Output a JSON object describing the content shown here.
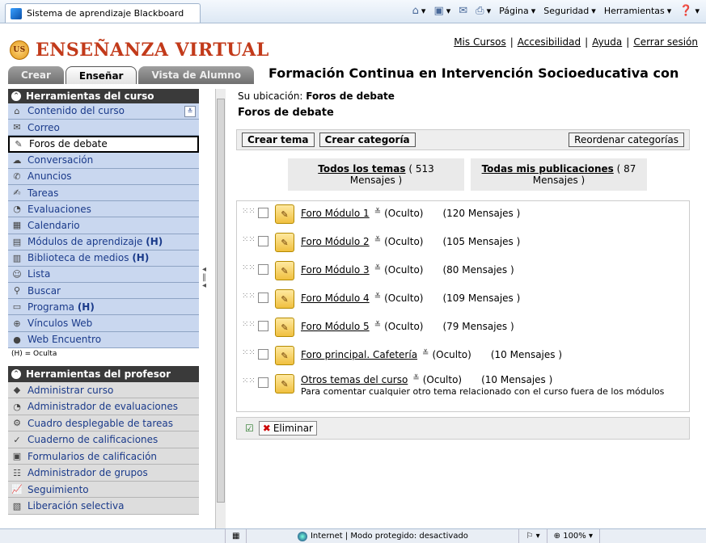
{
  "browser": {
    "tab_title": "Sistema de aprendizaje Blackboard",
    "commands": [
      "Página",
      "Seguridad",
      "Herramientas"
    ],
    "status": "Internet | Modo protegido: desactivado",
    "zoom": "100%"
  },
  "header": {
    "logo": "ENSEÑANZA VIRTUAL",
    "links": [
      "Mis Cursos",
      "Accesibilidad",
      "Ayuda",
      "Cerrar sesión"
    ],
    "tabs": [
      "Crear",
      "Enseñar",
      "Vista de Alumno"
    ],
    "course_title": "Formación Continua en Intervención Socioeducativa con"
  },
  "sidebar": {
    "course_tools_title": "Herramientas del curso",
    "items": [
      {
        "label": "Contenido del curso",
        "icon": "home-icon"
      },
      {
        "label": "Correo",
        "icon": "mail-icon"
      },
      {
        "label": "Foros de debate",
        "icon": "forum-icon"
      },
      {
        "label": "Conversación",
        "icon": "chat-icon"
      },
      {
        "label": "Anuncios",
        "icon": "megaphone-icon"
      },
      {
        "label": "Tareas",
        "icon": "assignment-icon"
      },
      {
        "label": "Evaluaciones",
        "icon": "assessment-icon"
      },
      {
        "label": "Calendario",
        "icon": "calendar-icon"
      },
      {
        "label": "Módulos de aprendizaje",
        "suffix": "(H)",
        "icon": "module-icon"
      },
      {
        "label": "Biblioteca de medios",
        "suffix": "(H)",
        "icon": "media-icon"
      },
      {
        "label": "Lista",
        "icon": "roster-icon"
      },
      {
        "label": "Buscar",
        "icon": "search-icon"
      },
      {
        "label": "Programa",
        "suffix": "(H)",
        "icon": "syllabus-icon"
      },
      {
        "label": "Vínculos Web",
        "icon": "weblink-icon"
      },
      {
        "label": "Web Encuentro",
        "icon": "meeting-icon"
      }
    ],
    "hidden_note": "(H) = Oculta",
    "instructor_tools_title": "Herramientas del profesor",
    "instructor_items": [
      {
        "label": "Administrar curso",
        "icon": "manage-icon"
      },
      {
        "label": "Administrador de evaluaciones",
        "icon": "assessment-manager-icon"
      },
      {
        "label": "Cuadro desplegable de tareas",
        "icon": "dropbox-icon"
      },
      {
        "label": "Cuaderno de calificaciones",
        "icon": "gradebook-icon"
      },
      {
        "label": "Formularios de calificación",
        "icon": "rubric-icon"
      },
      {
        "label": "Administrador de grupos",
        "icon": "groups-icon"
      },
      {
        "label": "Seguimiento",
        "icon": "tracking-icon"
      },
      {
        "label": "Liberación selectiva",
        "icon": "release-icon"
      }
    ]
  },
  "main": {
    "location_label": "Su ubicación:",
    "location_value": "Foros de debate",
    "page_title": "Foros de debate",
    "buttons": {
      "create_topic": "Crear tema",
      "create_category": "Crear categoría",
      "reorder": "Reordenar categorías"
    },
    "filters": [
      {
        "link": "Todos los temas",
        "count": "( 513",
        "sub": "Mensajes )"
      },
      {
        "link": "Todas mis publicaciones",
        "count": "( 87",
        "sub": "Mensajes )"
      }
    ],
    "forums": [
      {
        "name": "Foro Módulo 1",
        "status": "(Oculto)",
        "messages": "(120 Mensajes )",
        "desc": ""
      },
      {
        "name": "Foro Módulo 2",
        "status": "(Oculto)",
        "messages": "(105 Mensajes )",
        "desc": ""
      },
      {
        "name": "Foro Módulo 3",
        "status": "(Oculto)",
        "messages": "(80 Mensajes )",
        "desc": ""
      },
      {
        "name": "Foro Módulo 4",
        "status": "(Oculto)",
        "messages": "(109 Mensajes )",
        "desc": ""
      },
      {
        "name": "Foro Módulo 5",
        "status": "(Oculto)",
        "messages": "(79 Mensajes )",
        "desc": ""
      },
      {
        "name": "Foro principal. Cafetería",
        "status": "(Oculto)",
        "messages": "(10 Mensajes )",
        "desc": ""
      },
      {
        "name": "Otros temas del curso",
        "status": "(Oculto)",
        "messages": "(10 Mensajes )",
        "desc": "Para comentar cualquier otro tema relacionado con el curso fuera de los módulos"
      }
    ],
    "delete_label": "Eliminar"
  }
}
